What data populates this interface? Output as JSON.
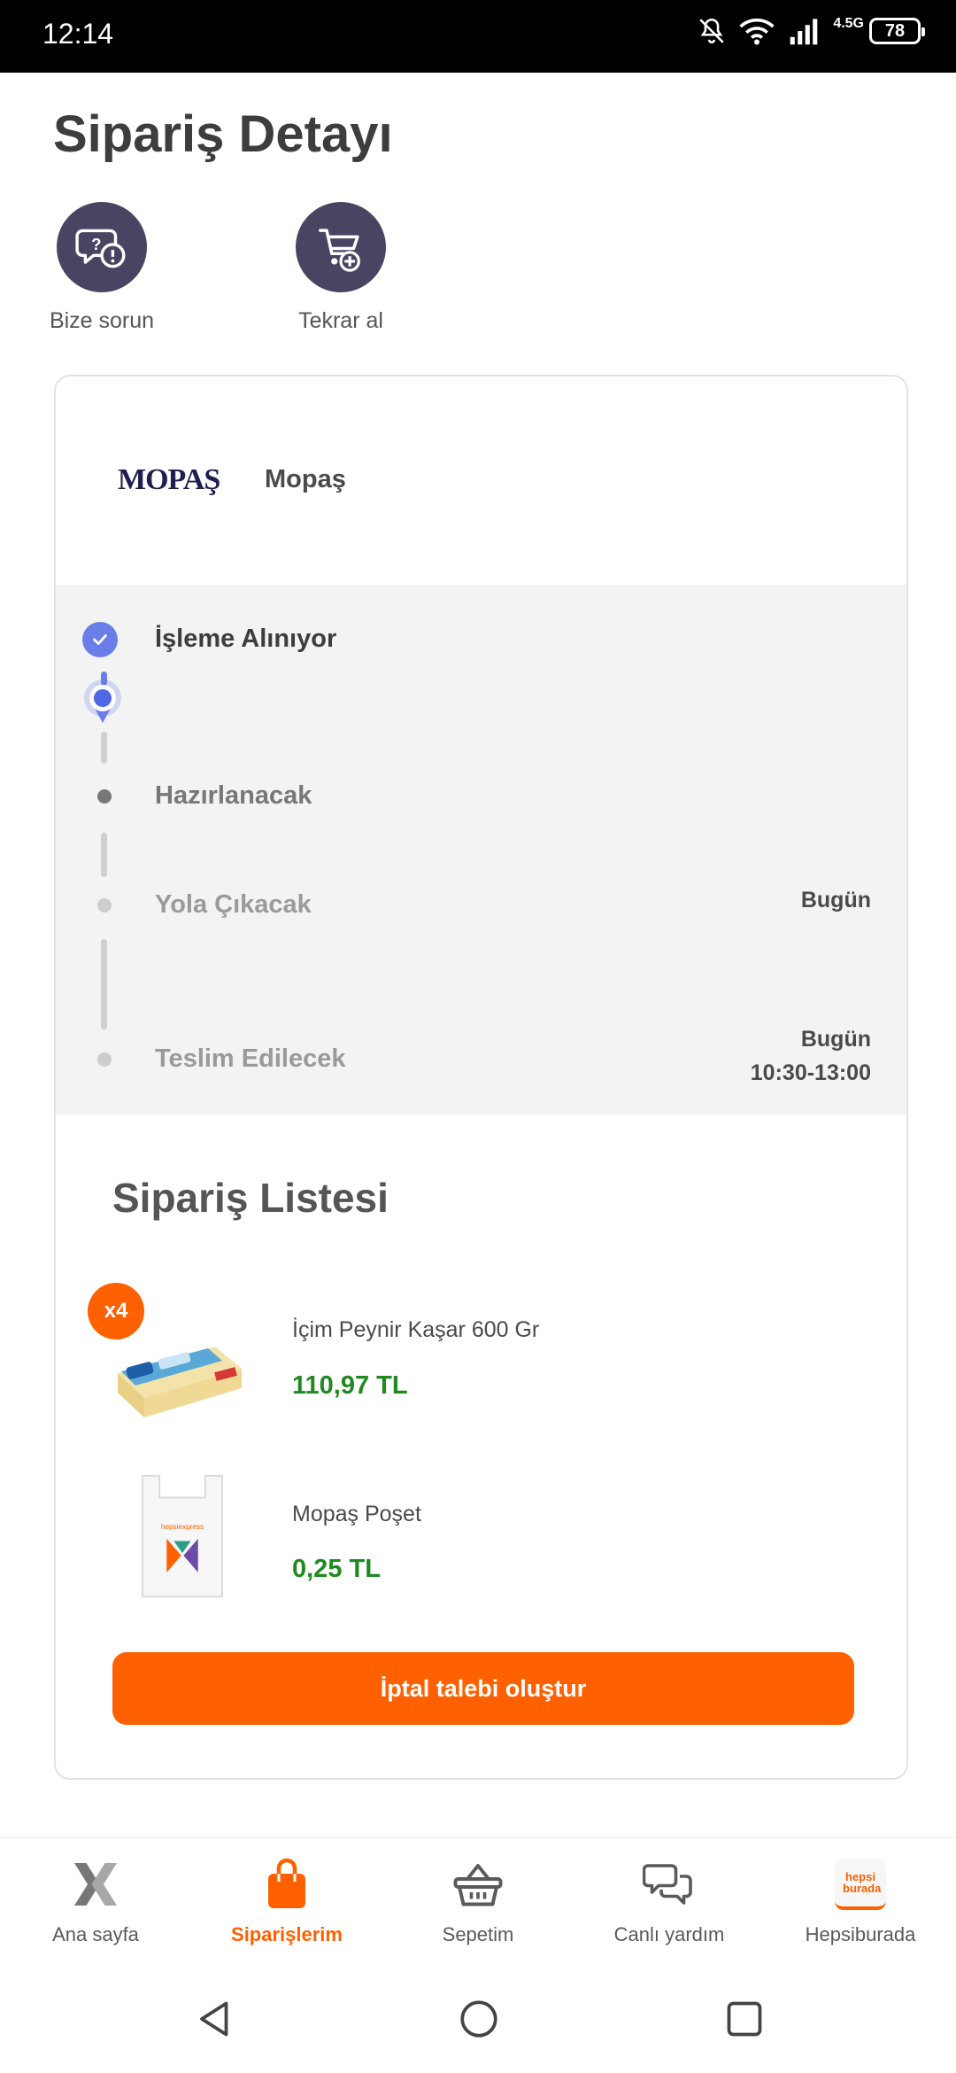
{
  "status_bar": {
    "time": "12:14",
    "network": "4.5G",
    "battery": "78"
  },
  "page": {
    "title": "Sipariş Detayı"
  },
  "actions": [
    {
      "label": "Bize sorun",
      "icon": "chat-question-icon"
    },
    {
      "label": "Tekrar al",
      "icon": "cart-add-icon"
    }
  ],
  "seller": {
    "logo_text": "MOPAŞ",
    "name": "Mopaş"
  },
  "timeline": {
    "steps": [
      {
        "label": "İşleme Alınıyor",
        "status": "done"
      },
      {
        "label": "Hazırlanacak",
        "status": "next"
      },
      {
        "label": "Yola Çıkacak",
        "status": "pending",
        "date": "Bugün"
      },
      {
        "label": "Teslim Edilecek",
        "status": "pending",
        "date": "Bugün",
        "time": "10:30-13:00"
      }
    ]
  },
  "order_list": {
    "title": "Sipariş Listesi",
    "items": [
      {
        "name": "İçim Peynir Kaşar 600 Gr",
        "price": "110,97 TL",
        "quantity_badge": "x4"
      },
      {
        "name": "Mopaş Poşet",
        "price": "0,25 TL"
      }
    ]
  },
  "cancel_button": {
    "label": "İptal talebi oluştur"
  },
  "bottom_nav": [
    {
      "label": "Ana sayfa",
      "icon": "x-logo-icon",
      "active": false
    },
    {
      "label": "Siparişlerim",
      "icon": "shopping-bag-icon",
      "active": true
    },
    {
      "label": "Sepetim",
      "icon": "basket-icon",
      "active": false
    },
    {
      "label": "Canlı yardım",
      "icon": "chat-bubbles-icon",
      "active": false
    },
    {
      "label": "Hepsiburada",
      "icon": "hepsiburada-logo-icon",
      "logo_text": "hepsi burada",
      "active": false
    }
  ],
  "colors": {
    "accent": "#ff6000",
    "price": "#1f8a1f",
    "timeline_active": "#6b7de8",
    "action_bg": "#484563"
  }
}
